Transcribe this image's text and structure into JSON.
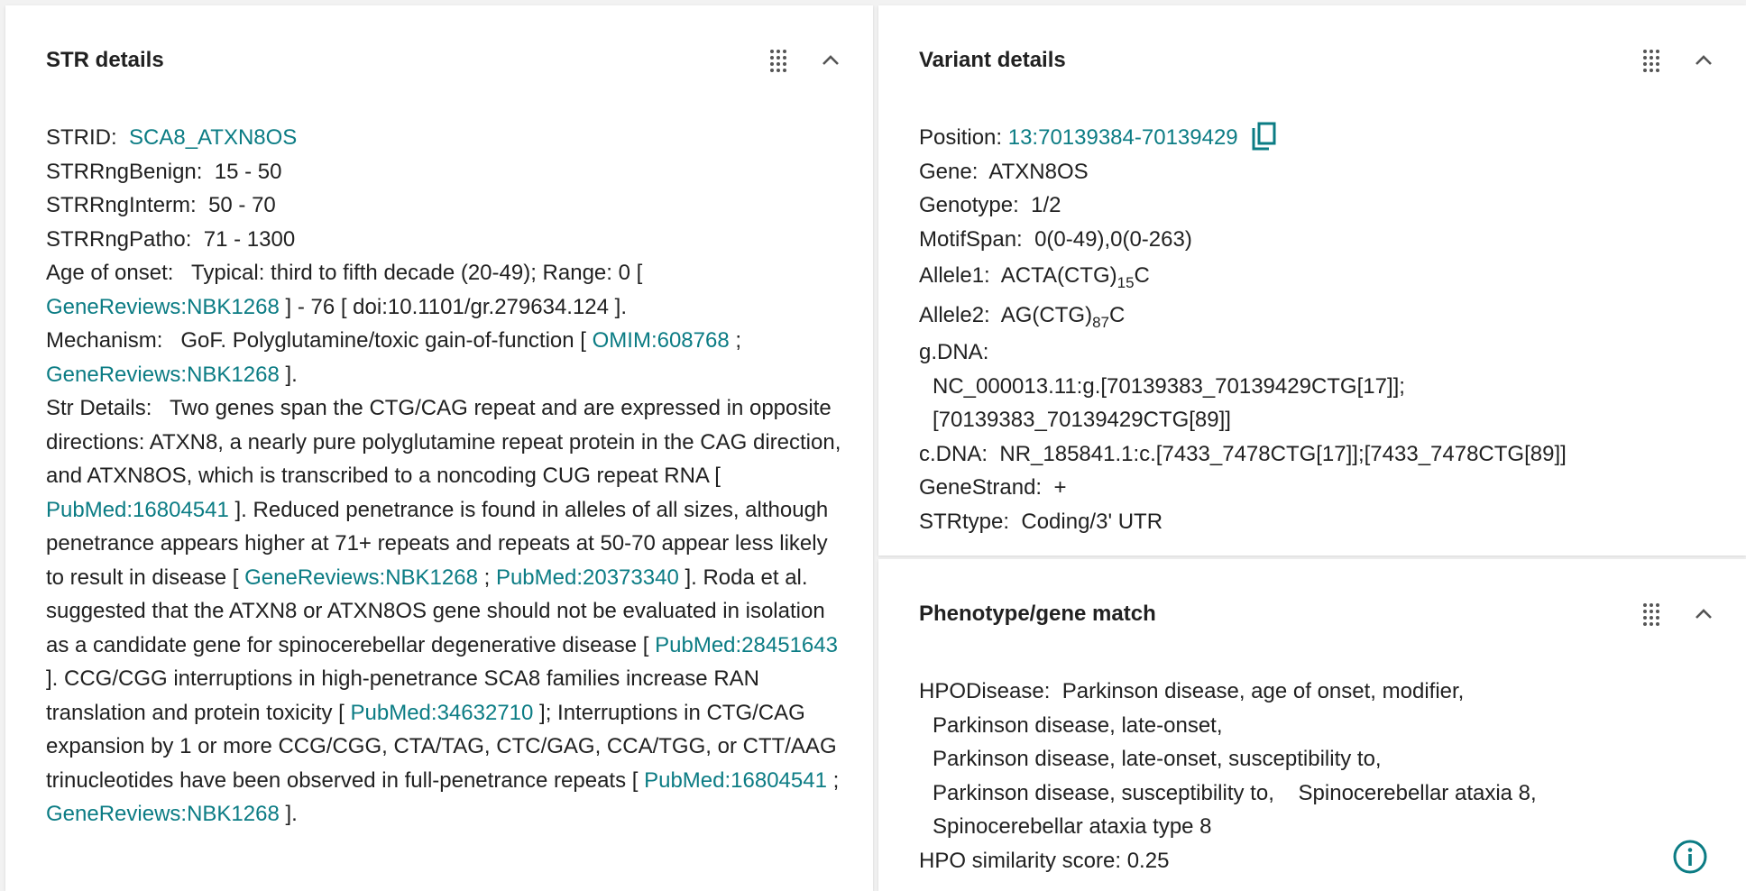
{
  "colors": {
    "link": "#0b7c84",
    "text": "#212121",
    "panel": "#ffffff",
    "background": "#f2f2f2"
  },
  "icons": {
    "grid": "drag-grid-icon",
    "collapse": "chevron-up-icon",
    "copy": "copy-icon",
    "info": "info-icon"
  },
  "str_details": {
    "title": "STR details",
    "strid_label": "STRID:",
    "strid_value": "SCA8_ATXN8OS",
    "benign_label": "STRRngBenign:",
    "benign_value": "15 - 50",
    "interm_label": "STRRngInterm:",
    "interm_value": "50 - 70",
    "patho_label": "STRRngPatho:",
    "patho_value": "71 - 1300",
    "onset_label": "Age of onset:",
    "onset_t1": "Typical: third to fifth decade (20-49); Range: 0 [",
    "onset_link1": "GeneReviews:NBK1268",
    "onset_t2": "] - 76 [ doi:10.1101/gr.279634.124 ].",
    "mech_label": "Mechanism:",
    "mech_t1": "GoF. Polyglutamine/toxic gain-of-function [",
    "mech_link1": "OMIM:608768",
    "mech_t2": ";",
    "mech_link2": "GeneReviews:NBK1268",
    "mech_t3": "].",
    "details_label": "Str Details:",
    "d_t1": "Two genes span the CTG/CAG repeat and are expressed in opposite directions: ATXN8, a nearly pure polyglutamine repeat protein in the CAG direction, and ATXN8OS, which is transcribed to a noncoding CUG repeat RNA [",
    "d_link1": "PubMed:16804541",
    "d_t2": "]. Reduced penetrance is found in alleles of all sizes, although penetrance appears higher at 71+ repeats and repeats at 50-70 appear less likely to result in disease [",
    "d_link2": "GeneReviews:NBK1268",
    "d_t3": ";",
    "d_link3": "PubMed:20373340",
    "d_t4": "]. Roda et al. suggested that the ATXN8 or ATXN8OS gene should not be evaluated in isolation as a candidate gene for spinocerebellar degenerative disease [",
    "d_link4": "PubMed:28451643",
    "d_t5": "]. CCG/CGG interruptions in high-penetrance SCA8 families increase RAN translation and protein toxicity [",
    "d_link5": "PubMed:34632710",
    "d_t6": "]; Interruptions in CTG/CAG expansion by 1 or more CCG/CGG, CTA/TAG, CTC/GAG, CCA/TGG, or CTT/AAG trinucleotides have been observed in full-penetrance repeats [",
    "d_link6": "PubMed:16804541",
    "d_t7": ";",
    "d_link7": "GeneReviews:NBK1268",
    "d_t8": "]."
  },
  "variant_details": {
    "title": "Variant details",
    "position_label": "Position:",
    "position_value": "13:70139384-70139429",
    "gene_label": "Gene:",
    "gene_value": "ATXN8OS",
    "genotype_label": "Genotype:",
    "genotype_value": "1/2",
    "motifspan_label": "MotifSpan:",
    "motifspan_value": "0(0-49),0(0-263)",
    "allele1_label": "Allele1:",
    "allele1_base": "ACTA(CTG)",
    "allele1_sub": "15",
    "allele1_tail": "C",
    "allele2_label": "Allele2:",
    "allele2_base": "AG(CTG)",
    "allele2_sub": "87",
    "allele2_tail": "C",
    "gdna_label": "g.DNA:",
    "gdna_line1": "NC_000013.11:g.[70139383_70139429CTG[17]];",
    "gdna_line2": "[70139383_70139429CTG[89]]",
    "cdna_label": "c.DNA:",
    "cdna_value": "NR_185841.1:c.[7433_7478CTG[17]];[7433_7478CTG[89]]",
    "strand_label": "GeneStrand:",
    "strand_value": "+",
    "strtype_label": "STRtype:",
    "strtype_value": "Coding/3' UTR"
  },
  "phenotype_match": {
    "title": "Phenotype/gene match",
    "hpo_label": "HPODisease:",
    "hpo_line1": "Parkinson disease, age of onset, modifier,",
    "hpo_line2": "Parkinson disease, late-onset,",
    "hpo_line3": "Parkinson disease, late-onset, susceptibility to,",
    "hpo_line4a": "Parkinson disease, susceptibility to,",
    "hpo_line4b": "Spinocerebellar ataxia 8,",
    "hpo_line5": "Spinocerebellar ataxia type 8",
    "score_label": "HPO similarity score:",
    "score_value": "0.25"
  }
}
